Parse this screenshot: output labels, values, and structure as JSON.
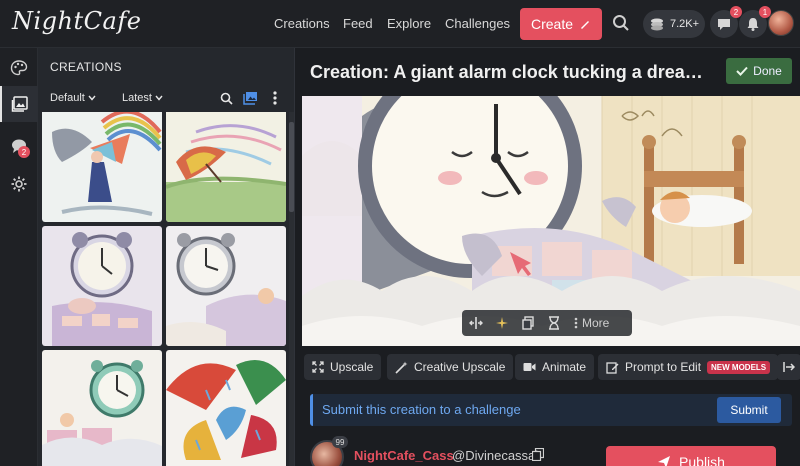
{
  "app": {
    "logo_text": "NightCafe"
  },
  "nav": {
    "links": [
      "Creations",
      "Feed",
      "Explore",
      "Challenges"
    ],
    "create_label": "Create",
    "credits": "7.2K+",
    "messages_badge": "2",
    "notifications_badge": "1",
    "accent_color": "#e4505f"
  },
  "rail": {
    "items": [
      "palette-icon",
      "gallery-icon",
      "chat-icon",
      "gear-icon"
    ],
    "chat_badge": "2"
  },
  "panel": {
    "title": "CREATIONS",
    "filter_label": "Default",
    "sort_label": "Latest",
    "thumbnails": [
      "girl-with-rainbow-umbrella",
      "umbrella-flying-in-wind",
      "alarm-clock-tucking-child-1",
      "alarm-clock-tucking-child-2",
      "teal-clock-in-clouds",
      "umbrellas-in-rain"
    ]
  },
  "main": {
    "title": "Creation: A giant alarm clock tucking a dreame...",
    "done_label": "Done",
    "image_toolbar_more": "More",
    "actions": [
      {
        "label": "Upscale",
        "icon": "expand-icon"
      },
      {
        "label": "Creative Upscale",
        "icon": "magic-wand-icon"
      },
      {
        "label": "Animate",
        "icon": "video-icon"
      },
      {
        "label": "Prompt to Edit",
        "icon": "edit-icon",
        "tag": "NEW MODELS"
      }
    ],
    "challenge_text": "Submit this creation to a challenge",
    "submit_label": "Submit",
    "author": {
      "name": "NightCafe_Cass",
      "handle": "@Divinecassai",
      "level": "99"
    },
    "publish_label": "Publish"
  }
}
